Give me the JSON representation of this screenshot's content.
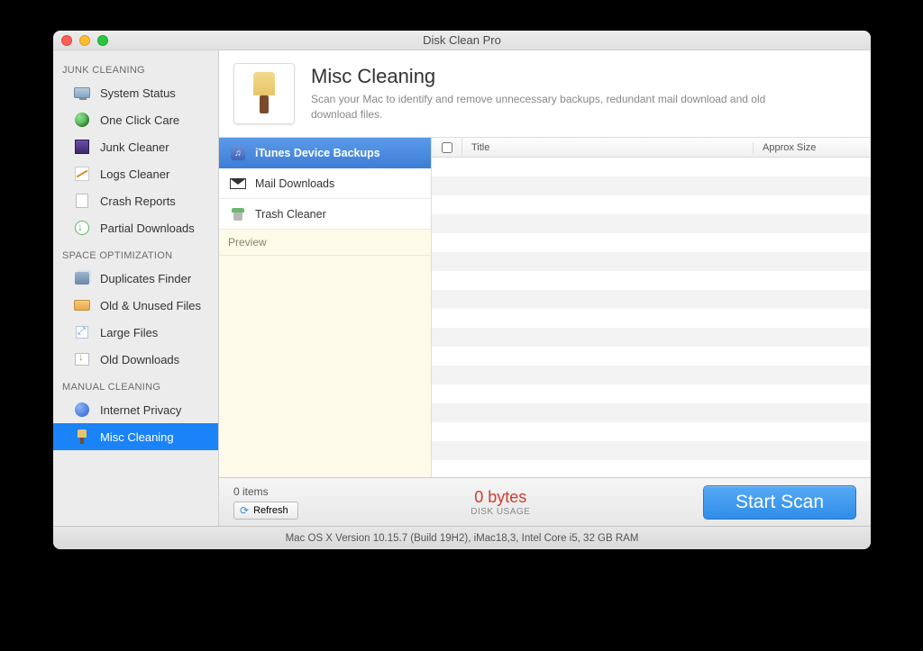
{
  "window": {
    "title": "Disk Clean Pro"
  },
  "sidebar": {
    "sections": {
      "junk": {
        "label": "JUNK CLEANING",
        "items": [
          {
            "label": "System Status"
          },
          {
            "label": "One Click Care"
          },
          {
            "label": "Junk Cleaner"
          },
          {
            "label": "Logs Cleaner"
          },
          {
            "label": "Crash Reports"
          },
          {
            "label": "Partial Downloads"
          }
        ]
      },
      "space": {
        "label": "SPACE OPTIMIZATION",
        "items": [
          {
            "label": "Duplicates Finder"
          },
          {
            "label": "Old & Unused Files"
          },
          {
            "label": "Large Files"
          },
          {
            "label": "Old Downloads"
          }
        ]
      },
      "manual": {
        "label": "MANUAL CLEANING",
        "items": [
          {
            "label": "Internet Privacy"
          },
          {
            "label": "Misc Cleaning"
          }
        ]
      }
    }
  },
  "header": {
    "title": "Misc Cleaning",
    "subtitle": "Scan your Mac to identify and remove unnecessary backups, redundant mail download and old download files."
  },
  "categories": {
    "items": [
      {
        "label": "iTunes Device Backups"
      },
      {
        "label": "Mail Downloads"
      },
      {
        "label": "Trash Cleaner"
      }
    ],
    "preview_label": "Preview"
  },
  "results": {
    "columns": {
      "title": "Title",
      "size": "Approx Size"
    }
  },
  "footer": {
    "items_label": "0 items",
    "refresh_label": "Refresh",
    "bytes_label": "0 bytes",
    "disk_usage_label": "DISK USAGE",
    "start_label": "Start Scan"
  },
  "statusbar": {
    "text": "Mac OS X Version 10.15.7 (Build 19H2), iMac18,3, Intel Core i5, 32 GB RAM"
  }
}
